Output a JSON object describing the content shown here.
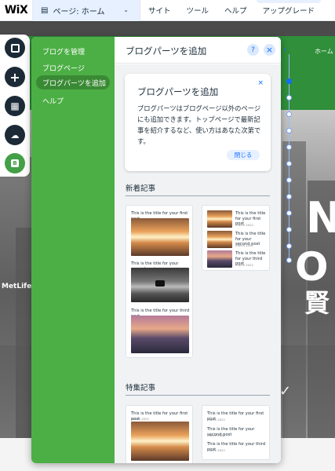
{
  "topbar": {
    "logo": "WiX",
    "page_selector": "ページ: ホーム",
    "menu": [
      "サイト",
      "ツール",
      "ヘルプ",
      "アップグレード"
    ]
  },
  "canvas": {
    "home_label": "ホーム",
    "big_letters": [
      "N",
      "O",
      "賢"
    ],
    "metlife": "MetLife"
  },
  "rail": {
    "blog_badge": "B"
  },
  "panel": {
    "title": "ブログパーツを追加",
    "help_icon": "?",
    "close_icon": "×",
    "nav": [
      "ブログを管理",
      "ブログページ",
      "ブログパーツを追加",
      "ヘルプ"
    ],
    "info": {
      "title": "ブログパーツを追加",
      "body": "ブログパーツはブログページ以外のページにも追加できます。トップページで最新記事を紹介するなど、使い方はあなた次第です。",
      "close_x": "×",
      "button": "閉じる"
    },
    "sections": {
      "recent": "新着記事",
      "featured": "特集記事"
    },
    "posts": {
      "first": "This is the title for your first post",
      "second": "This is the title for your second post",
      "third": "This is the title for your third post",
      "first_short": "This is the title for your first post",
      "second_short": "This is the title for your second post",
      "third_short": "This is the title for your third post",
      "date": "march 2022"
    }
  },
  "colors": {
    "panel_nav": "#4caf45",
    "accent": "#116dff"
  }
}
